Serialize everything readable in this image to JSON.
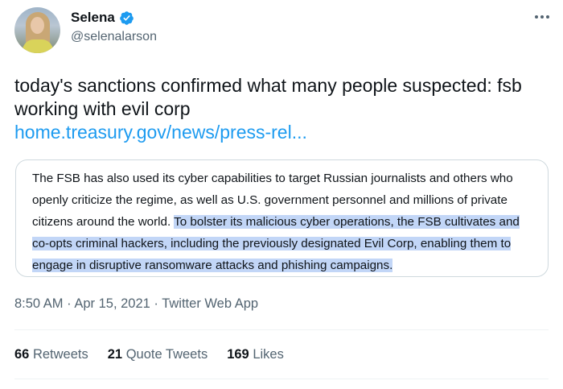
{
  "author": {
    "display_name": "Selena",
    "handle": "@selenalarson"
  },
  "tweet": {
    "text": "today's sanctions confirmed what many people suspected: fsb working with evil corp",
    "link_text": "home.treasury.gov/news/press-rel..."
  },
  "quote": {
    "plain": "The FSB has also used its cyber capabilities to target Russian journalists and others who openly criticize the regime, as well as U.S. government personnel and millions of private citizens around the world. ",
    "highlighted": "To bolster its malicious cyber operations, the FSB cultivates and co-opts criminal hackers, including the previously designated Evil Corp, enabling them to engage in disruptive ransomware attacks and phishing campaigns."
  },
  "meta": {
    "time": "8:50 AM",
    "date": "Apr 15, 2021",
    "source": "Twitter Web App",
    "separator": "·"
  },
  "stats": [
    {
      "value": "66",
      "label": "Retweets"
    },
    {
      "value": "21",
      "label": "Quote Tweets"
    },
    {
      "value": "169",
      "label": "Likes"
    }
  ],
  "icons": {
    "verified": "verified-badge-icon",
    "more": "more-options-icon"
  },
  "colors": {
    "link": "#1d9bf0",
    "secondary_text": "#536471",
    "highlight": "#c2d6f7"
  }
}
